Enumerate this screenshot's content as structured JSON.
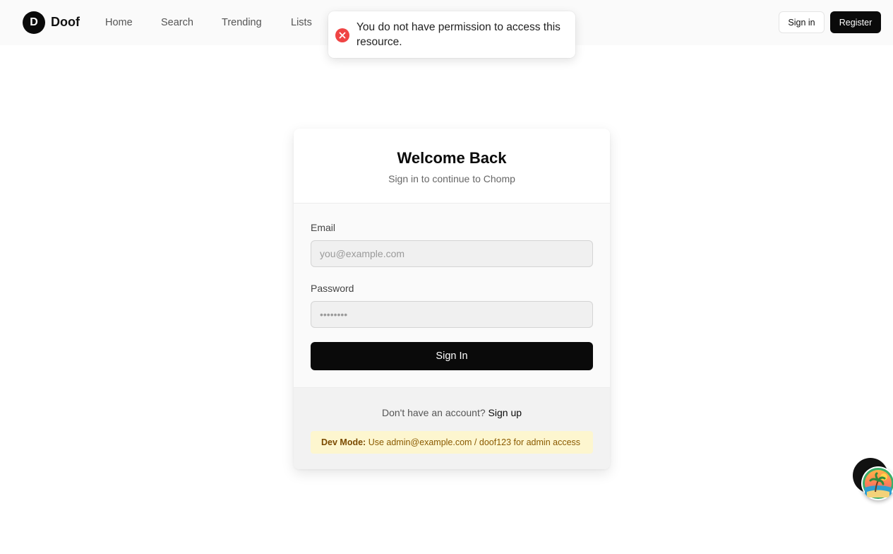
{
  "brand": {
    "logo_letter": "D",
    "name": "Doof"
  },
  "nav": {
    "items": [
      "Home",
      "Search",
      "Trending",
      "Lists"
    ]
  },
  "header": {
    "signin_label": "Sign in",
    "register_label": "Register"
  },
  "toast": {
    "message": "You do not have permission to access this resource.",
    "status_color": "#ef4444"
  },
  "login": {
    "title": "Welcome Back",
    "subtitle": "Sign in to continue to Chomp",
    "email_label": "Email",
    "email_placeholder": "you@example.com",
    "email_value": "",
    "password_label": "Password",
    "password_placeholder": "••••••••",
    "password_value": "",
    "submit_label": "Sign In",
    "signup_prompt": "Don't have an account?",
    "signup_link": "Sign up",
    "dev_mode_label": "Dev Mode:",
    "dev_mode_text": "Use admin@example.com / doof123 for admin access"
  },
  "colors": {
    "primary": "#0a0a0a",
    "error": "#ef4444",
    "dev_bg": "#fdf6cf"
  },
  "icons": {
    "toast": "error-x-icon",
    "floating": "beach-avatar-icon"
  }
}
